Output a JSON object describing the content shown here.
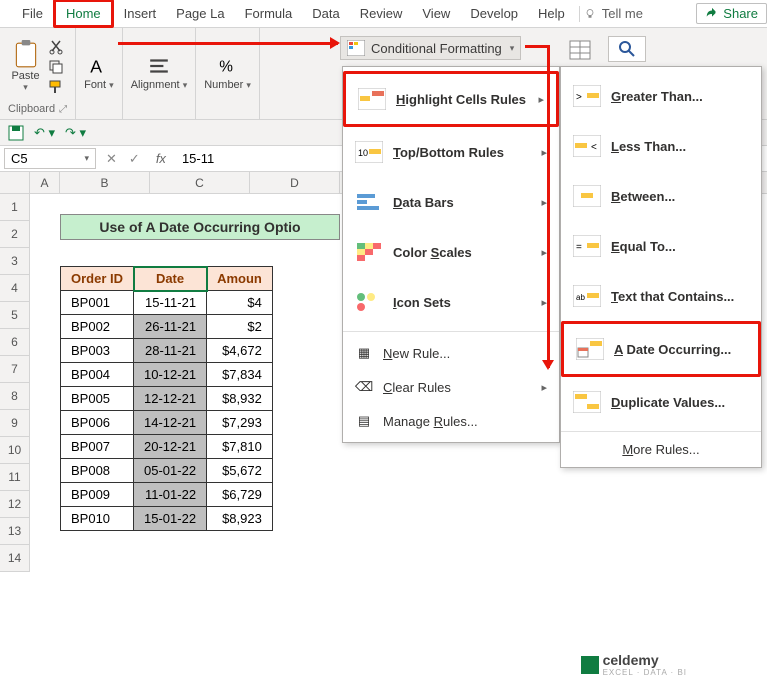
{
  "tabs": {
    "file": "File",
    "home": "Home",
    "insert": "Insert",
    "page": "Page La",
    "formula": "Formula",
    "data": "Data",
    "review": "Review",
    "view": "View",
    "develop": "Develop",
    "help": "Help",
    "tellme": "Tell me",
    "share": "Share"
  },
  "ribbon": {
    "paste": "Paste",
    "clipboard": "Clipboard",
    "font": "Font",
    "alignment": "Alignment",
    "number": "Number",
    "cf": "Conditional Formatting"
  },
  "namebox": "C5",
  "formula": "15-11",
  "fx": "fx",
  "cols": {
    "A": "A",
    "B": "B",
    "C": "C",
    "D": "D"
  },
  "title": "Use of A Date Occurring Optio",
  "headers": {
    "order": "Order ID",
    "date": "Date",
    "amount": "Amoun"
  },
  "rows": [
    {
      "n": "5",
      "id": "BP001",
      "date": "15-11-21",
      "amt": "$4"
    },
    {
      "n": "6",
      "id": "BP002",
      "date": "26-11-21",
      "amt": "$2"
    },
    {
      "n": "7",
      "id": "BP003",
      "date": "28-11-21",
      "amt": "$4,672"
    },
    {
      "n": "8",
      "id": "BP004",
      "date": "10-12-21",
      "amt": "$7,834"
    },
    {
      "n": "9",
      "id": "BP005",
      "date": "12-12-21",
      "amt": "$8,932"
    },
    {
      "n": "10",
      "id": "BP006",
      "date": "14-12-21",
      "amt": "$7,293"
    },
    {
      "n": "11",
      "id": "BP007",
      "date": "20-12-21",
      "amt": "$7,810"
    },
    {
      "n": "12",
      "id": "BP008",
      "date": "05-01-22",
      "amt": "$5,672"
    },
    {
      "n": "13",
      "id": "BP009",
      "date": "11-01-22",
      "amt": "$6,729"
    },
    {
      "n": "14",
      "id": "BP010",
      "date": "15-01-22",
      "amt": "$8,923"
    }
  ],
  "menu1": {
    "highlight": "Highlight Cells Rules",
    "topbottom": "Top/Bottom Rules",
    "databars": "Data Bars",
    "colorscales": "Color Scales",
    "iconsets": "Icon Sets",
    "newrule": "New Rule...",
    "clear": "Clear Rules",
    "manage": "Manage Rules..."
  },
  "menu2": {
    "greater": "Greater Than...",
    "less": "Less Than...",
    "between": "Between...",
    "equal": "Equal To...",
    "text": "Text that Contains...",
    "date": "A Date Occurring...",
    "dup": "Duplicate Values...",
    "more": "More Rules..."
  },
  "watermark": {
    "name": "celdemy",
    "sub": "EXCEL · DATA · BI"
  }
}
